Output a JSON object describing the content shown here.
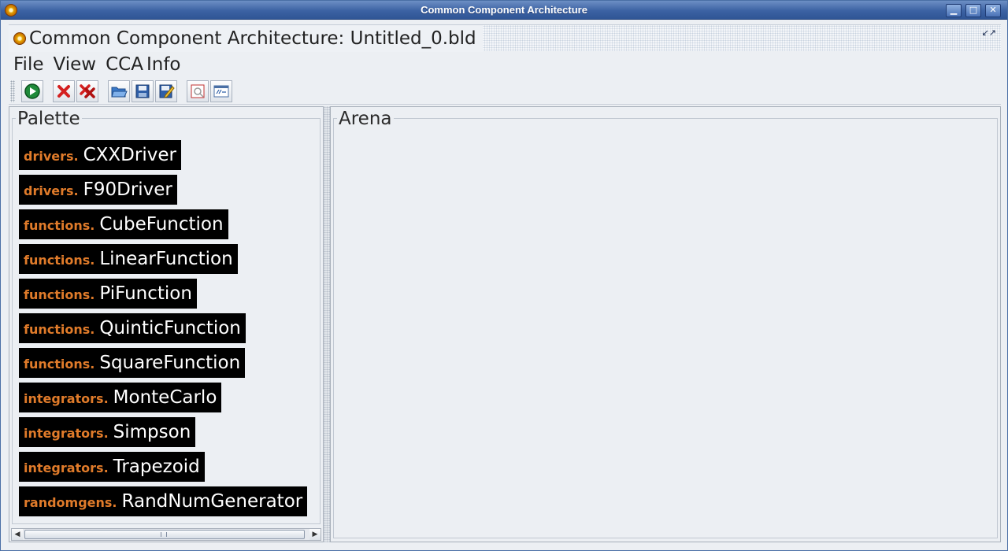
{
  "window": {
    "title": "Common Component Architecture",
    "controls": {
      "minimize": "▁",
      "maximize": "□",
      "close": "✕"
    }
  },
  "frame": {
    "title": "Common Component Architecture: Untitled_0.bld",
    "restore": "↙↗"
  },
  "menu": {
    "items": [
      "File",
      "View",
      "CCA",
      "Info"
    ]
  },
  "toolbar": {
    "buttons": [
      {
        "icon": "run-icon"
      },
      {
        "icon": "delete-icon"
      },
      {
        "icon": "delete-all-icon"
      },
      {
        "icon": "open-folder-icon"
      },
      {
        "icon": "save-icon"
      },
      {
        "icon": "save-as-icon"
      },
      {
        "icon": "debug-icon"
      },
      {
        "icon": "console-icon"
      }
    ]
  },
  "palette": {
    "title": "Palette",
    "components": [
      {
        "package": "drivers.",
        "name": "CXXDriver"
      },
      {
        "package": "drivers.",
        "name": "F90Driver"
      },
      {
        "package": "functions.",
        "name": "CubeFunction"
      },
      {
        "package": "functions.",
        "name": "LinearFunction"
      },
      {
        "package": "functions.",
        "name": "PiFunction"
      },
      {
        "package": "functions.",
        "name": "QuinticFunction"
      },
      {
        "package": "functions.",
        "name": "SquareFunction"
      },
      {
        "package": "integrators.",
        "name": "MonteCarlo"
      },
      {
        "package": "integrators.",
        "name": "Simpson"
      },
      {
        "package": "integrators.",
        "name": "Trapezoid"
      },
      {
        "package": "randomgens.",
        "name": "RandNumGenerator"
      }
    ],
    "scroll": {
      "left": "◀",
      "right": "▶"
    }
  },
  "arena": {
    "title": "Arena"
  },
  "colors": {
    "package_text": "#e07b2a",
    "component_bg": "#000000",
    "titlebar": "#3c62a3"
  }
}
